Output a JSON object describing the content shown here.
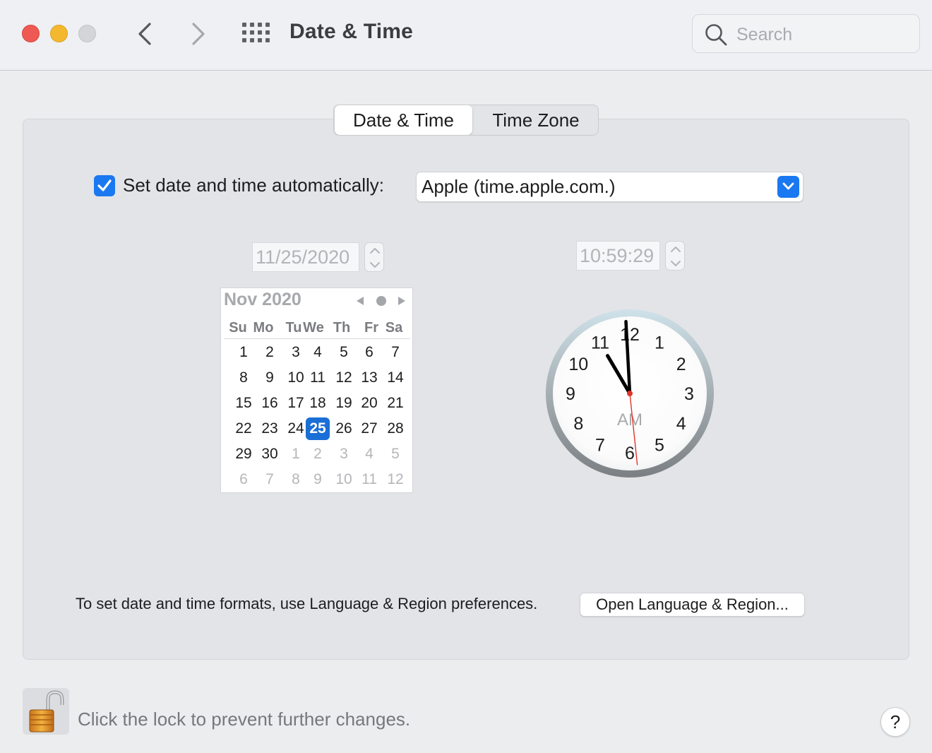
{
  "window": {
    "title": "Date & Time",
    "search_placeholder": "Search"
  },
  "tabs": [
    {
      "label": "Date & Time",
      "active": true
    },
    {
      "label": "Time Zone",
      "active": false
    }
  ],
  "auto": {
    "checked": true,
    "label": "Set date and time automatically:",
    "server": "Apple (time.apple.com.)"
  },
  "date_field": "11/25/2020",
  "time_field": "10:59:29",
  "calendar": {
    "title": "Nov 2020",
    "weekdays": [
      "Su",
      "Mo",
      "Tu",
      "We",
      "Th",
      "Fr",
      "Sa"
    ],
    "weeks": [
      [
        "1",
        "2",
        "3",
        "4",
        "5",
        "6",
        "7"
      ],
      [
        "8",
        "9",
        "10",
        "11",
        "12",
        "13",
        "14"
      ],
      [
        "15",
        "16",
        "17",
        "18",
        "19",
        "20",
        "21"
      ],
      [
        "22",
        "23",
        "24",
        "25",
        "26",
        "27",
        "28"
      ],
      [
        "29",
        "30",
        "1",
        "2",
        "3",
        "4",
        "5"
      ],
      [
        "6",
        "7",
        "8",
        "9",
        "10",
        "11",
        "12"
      ]
    ],
    "selected": "25"
  },
  "clock": {
    "numbers": [
      "12",
      "1",
      "2",
      "3",
      "4",
      "5",
      "6",
      "7",
      "8",
      "9",
      "10",
      "11"
    ],
    "meridiem": "AM",
    "hour": 10,
    "minute": 59,
    "second": 29
  },
  "formats": {
    "text": "To set date and time formats, use Language & Region preferences.",
    "button": "Open Language & Region..."
  },
  "lock_text": "Click the lock to prevent further changes.",
  "help_label": "?",
  "colors": {
    "accent": "#1a78f1",
    "selected_day": "#1a6fd6",
    "second_hand": "#e0352b"
  }
}
